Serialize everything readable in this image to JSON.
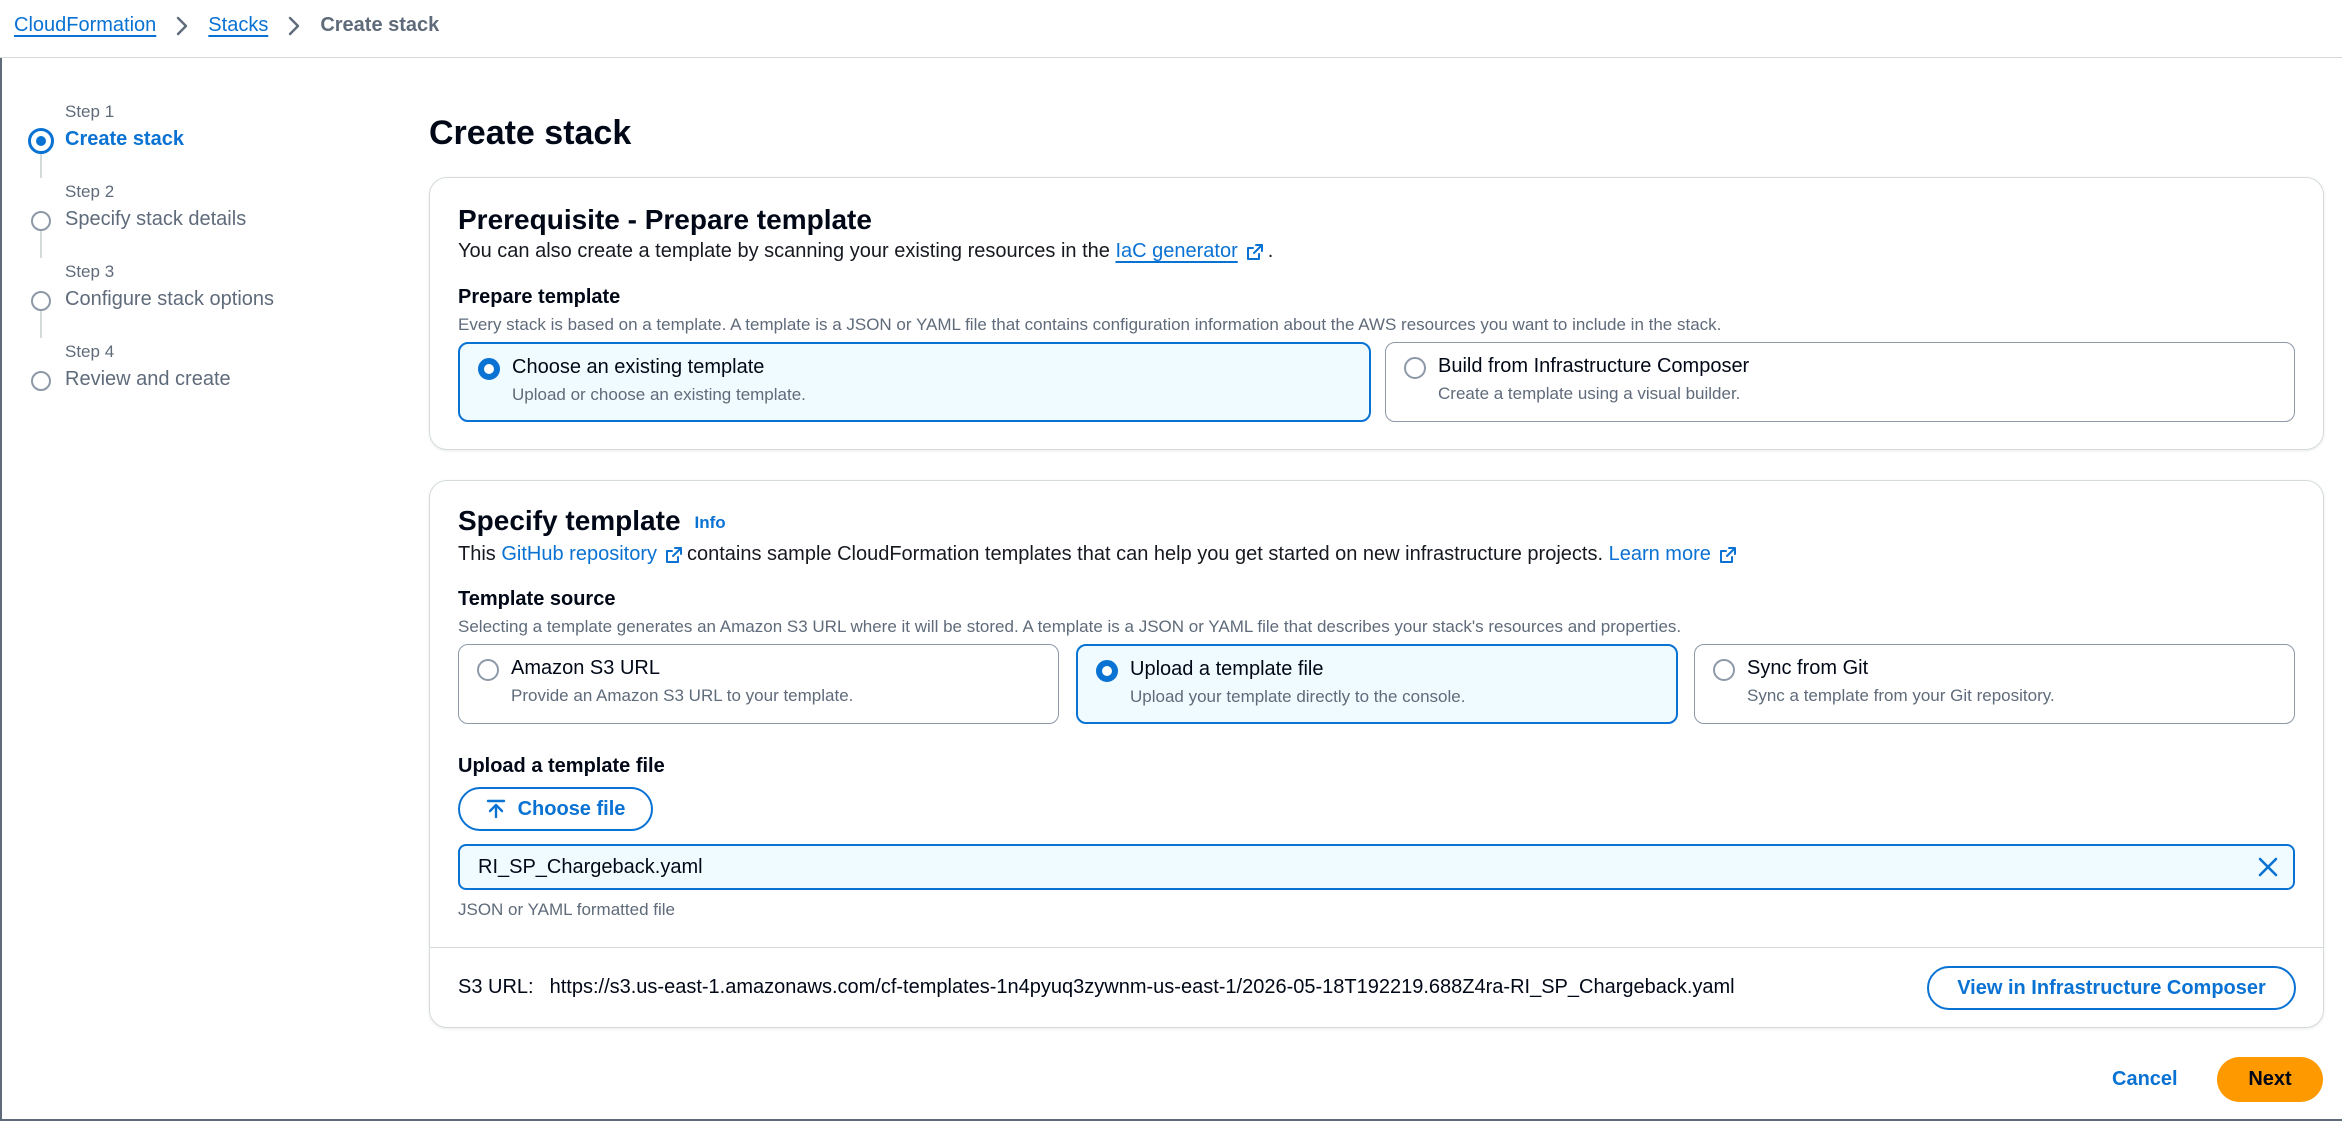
{
  "breadcrumbs": {
    "items": [
      {
        "label": "CloudFormation",
        "link": true
      },
      {
        "label": "Stacks",
        "link": true
      },
      {
        "label": "Create stack",
        "link": false
      }
    ]
  },
  "wizard": {
    "steps": [
      {
        "number": "Step 1",
        "title": "Create stack",
        "active": true
      },
      {
        "number": "Step 2",
        "title": "Specify stack details",
        "active": false
      },
      {
        "number": "Step 3",
        "title": "Configure stack options",
        "active": false
      },
      {
        "number": "Step 4",
        "title": "Review and create",
        "active": false
      }
    ]
  },
  "page": {
    "title": "Create stack"
  },
  "prerequisite": {
    "heading": "Prerequisite - Prepare template",
    "intro_before": "You can also create a template by scanning your existing resources in the",
    "intro_link": "IaC generator",
    "intro_after": ".",
    "field_label": "Prepare template",
    "field_description": "Every stack is based on a template. A template is a JSON or YAML file that contains configuration information about the AWS resources you want to include in the stack.",
    "options": [
      {
        "title": "Choose an existing template",
        "description": "Upload or choose an existing template.",
        "selected": true
      },
      {
        "title": "Build from Infrastructure Composer",
        "description": "Create a template using a visual builder.",
        "selected": false
      }
    ]
  },
  "specify": {
    "heading": "Specify template",
    "info": "Info",
    "intro_before": "This",
    "intro_link": "GitHub repository",
    "intro_middle": "contains sample CloudFormation templates that can help you get started on new infrastructure projects.",
    "intro_learn": "Learn more",
    "source_label": "Template source",
    "source_description": "Selecting a template generates an Amazon S3 URL where it will be stored. A template is a JSON or YAML file that describes your stack's resources and properties.",
    "sources": [
      {
        "title": "Amazon S3 URL",
        "description": "Provide an Amazon S3 URL to your template.",
        "selected": false
      },
      {
        "title": "Upload a template file",
        "description": "Upload your template directly to the console.",
        "selected": true
      },
      {
        "title": "Sync from Git",
        "description": "Sync a template from your Git repository.",
        "selected": false
      }
    ],
    "upload_label": "Upload a template file",
    "choose_file": "Choose file",
    "file_name": "RI_SP_Chargeback.yaml",
    "file_hint": "JSON or YAML formatted file",
    "s3_label": "S3 URL:",
    "s3_value": "https://s3.us-east-1.amazonaws.com/cf-templates-1n4pyuq3zywnm-us-east-1/2026-05-18T192219.688Z4ra-RI_SP_Chargeback.yaml",
    "view_composer": "View in Infrastructure Composer"
  },
  "footer": {
    "cancel": "Cancel",
    "next": "Next"
  },
  "colors": {
    "accent": "#0972d3",
    "primary_button": "#ff9900",
    "selected_bg": "#f0fbff"
  },
  "icons": [
    "chevron-right-icon",
    "external-link-icon",
    "upload-icon",
    "close-icon",
    "radio-icon",
    "step-indicator-icon"
  ]
}
